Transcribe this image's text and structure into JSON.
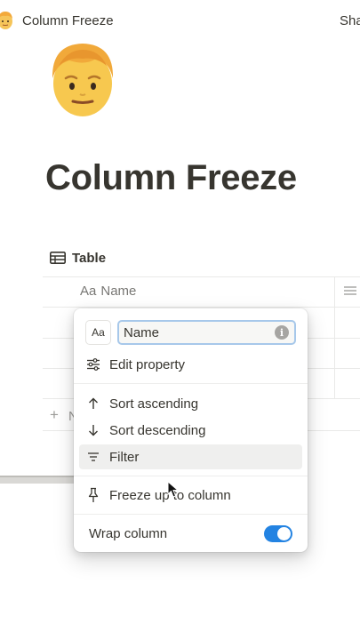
{
  "topbar": {
    "title": "Column Freeze",
    "share_label": "Sha",
    "emoji_icon": "man-emoji-icon"
  },
  "page": {
    "title": "Column Freeze",
    "emoji_icon": "man-emoji-icon"
  },
  "table": {
    "view_label": "Table",
    "column_header": {
      "type_icon": "Aa",
      "name": "Name"
    },
    "new_row_icon": "+",
    "new_row_text": "N"
  },
  "popup": {
    "type_button": "Aa",
    "name_value": "Name",
    "info_icon": "i",
    "items": [
      {
        "label": "Edit property",
        "icon": "sliders-icon"
      },
      {
        "label": "Sort ascending",
        "icon": "arrow-up-icon"
      },
      {
        "label": "Sort descending",
        "icon": "arrow-down-icon"
      },
      {
        "label": "Filter",
        "icon": "filter-icon"
      },
      {
        "label": "Freeze up to column",
        "icon": "pin-icon"
      }
    ],
    "wrap_label": "Wrap column",
    "wrap_enabled": true
  },
  "colors": {
    "accent": "#2383e2",
    "text": "#37352f",
    "muted": "#787774",
    "focus_ring": "#a7c8ea"
  }
}
